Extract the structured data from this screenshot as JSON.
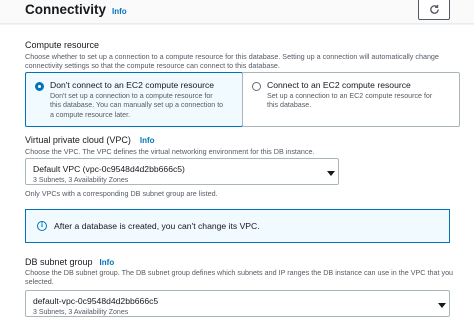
{
  "header": {
    "title": "Connectivity",
    "info": "Info",
    "refresh_icon": "refresh-icon"
  },
  "compute": {
    "label": "Compute resource",
    "description_line1": "Choose whether to set up a connection to a compute resource for this database. Setting up a connection will automatically change",
    "description_line2": "connectivity settings so that the compute resource can connect to this database.",
    "options": [
      {
        "title": "Don't connect to an EC2 compute resource",
        "desc_line1": "Don't set up a connection to a compute resource for",
        "desc_line2": "this database. You can manually set up a connection to",
        "desc_line3": "a compute resource later.",
        "selected": true
      },
      {
        "title": "Connect to an EC2 compute resource",
        "desc_line1": "Set up a connection to an EC2 compute resource for",
        "desc_line2": "this database.",
        "desc_line3": "",
        "selected": false
      }
    ]
  },
  "vpc": {
    "label": "Virtual private cloud (VPC)",
    "info": "Info",
    "description": "Choose the VPC. The VPC defines the virtual networking environment for this DB instance.",
    "value": "Default VPC (vpc-0c9548d4d2bb666c5)",
    "sub": "3 Subnets, 3 Availability Zones",
    "hint": "Only VPCs with a corresponding DB subnet group are listed."
  },
  "alert": {
    "icon": "info-circle-icon",
    "text": "After a database is created, you can't change its VPC.",
    "accent": "#0073bb"
  },
  "subnet": {
    "label": "DB subnet group",
    "info": "Info",
    "description_line1": "Choose the DB subnet group. The DB subnet group defines which subnets and IP ranges the DB instance can use in the VPC that you",
    "description_line2": "selected.",
    "value": "default-vpc-0c9548d4d2bb666c5",
    "sub": "3 Subnets, 3 Availability Zones"
  }
}
